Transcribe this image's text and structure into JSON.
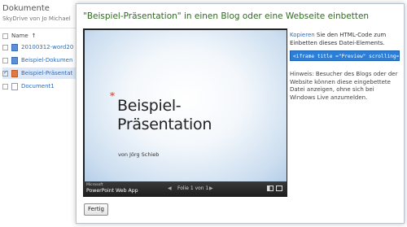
{
  "background": {
    "title": "Dokumente",
    "subtitle": "SkyDrive von Jo Michael",
    "name_header": "Name",
    "sort_indicator": "↑",
    "files": [
      {
        "name": "20100312-word20",
        "icon": "word-file-icon",
        "selected": false
      },
      {
        "name": "Beispiel-Dokumen",
        "icon": "word-file-icon",
        "selected": false
      },
      {
        "name": "Beispiel-Präsentat",
        "icon": "ppt-file-icon",
        "selected": true
      },
      {
        "name": "Document1",
        "icon": "blank-file-icon",
        "selected": false
      }
    ]
  },
  "dialog": {
    "title": "\"Beispiel-Präsentation\" in einen Blog oder eine Webseite einbetten",
    "preview": {
      "slide_title_line1": "Beispiel-",
      "slide_title_line2": "Präsentation",
      "slide_subtitle": "von Jörg Schieb",
      "ms_label": "Microsoft",
      "app_label": "PowerPoint Web App",
      "prev_symbol": "◀",
      "page_info": "Folie 1 von 1",
      "next_symbol": "▶"
    },
    "instructions": {
      "link": "Kopieren",
      "text": " Sie den HTML-Code zum Einbetten dieses Datei-Elements."
    },
    "embed_code": "<iframe title =\"Preview\" scrolling=\"no",
    "note": "Hinweis: Besucher des Blogs oder der Website können diese eingebettete Datei anzeigen, ohne sich bei Windows Live anzumelden.",
    "done_button": "Fertig"
  },
  "colors": {
    "title_green": "#2f6b1f",
    "link_blue": "#2a6cc0",
    "code_highlight": "#2c7fd8",
    "accent_star": "#d23b1e"
  }
}
